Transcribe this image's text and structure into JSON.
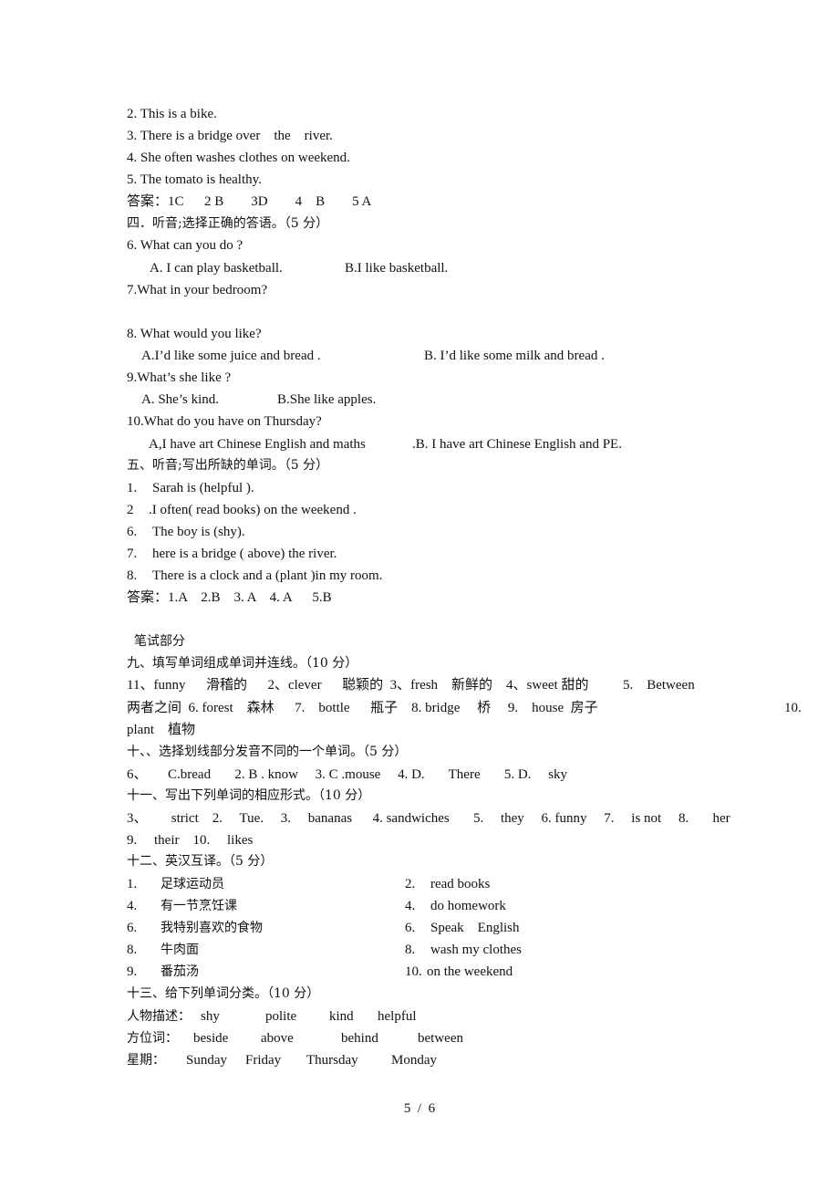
{
  "section3_tail": {
    "items": [
      "2. This is a bike.",
      "3. There is a bridge over    the    river.",
      "4. She often washes clothes on weekend.",
      "5. The tomato is healthy."
    ],
    "answer": "答案：1C      2 B        3D        4    B        5 A"
  },
  "section4": {
    "heading": "四．听音;选择正确的答语。（5 分）",
    "q6": "6. What can you do ?",
    "q6_a": "A. I can play basketball.",
    "q6_b": "B.I like basketball.",
    "q7": "7.What in your bedroom?",
    "q8": "8. What would you like?",
    "q8_a": "A.I’d like some juice and bread .",
    "q8_b": "B. I’d like some milk and bread .",
    "q9": "9.What’s she like ?",
    "q9_a": "A. She’s kind.",
    "q9_b": "B.She like apples.",
    "q10": "10.What do you have on Thursday?",
    "q10_a": "A,I have art Chinese English and maths",
    "q10_b": ".B. I have art Chinese English and PE."
  },
  "section5": {
    "heading": "五、听音;写出所缺的单词。（5 分）",
    "items": [
      {
        "num": "1.",
        "text": "Sarah is (helpful )."
      },
      {
        "num": "2",
        "text": ".I often( read books) on the weekend ."
      },
      {
        "num": "6.",
        "text": "The boy is (shy)."
      },
      {
        "num": "7.",
        "text": "here is a bridge ( above) the river."
      },
      {
        "num": "8.",
        "text": "There is a clock and a (plant )in my room."
      }
    ],
    "answer": "答案：1.A    2.B    3. A    4. A      5.B"
  },
  "written": {
    "heading": "笔试部分"
  },
  "section9": {
    "heading": "九、填写单词组成单词并连线。（10 分）",
    "line1": "11、funny      滑稽的      2、clever      聪颖的  3、fresh    新鲜的    4、sweet 甜的          5.    Between",
    "line2": "两者之间  6. forest    森林      7.    bottle      瓶子    8. bridge     桥     9.    house  房子",
    "line2_end": "10.",
    "line3": "plant    植物"
  },
  "section10": {
    "heading": "十、、选择划线部分发音不同的一个单词。（5 分）",
    "answer": "6、      C.bread       2. B . know     3. C .mouse     4. D.       There       5. D.     sky"
  },
  "section11": {
    "heading": "十一、写出下列单词的相应形式。（10 分）",
    "line1": "3、       strict    2.     Tue.     3.     bananas      4. sandwiches       5.     they     6. funny     7.     is not     8.       her",
    "line2": "9.     their    10.     likes"
  },
  "section12": {
    "heading": "十二、英汉互译。（5 分）",
    "rows": [
      {
        "l_num": "1.",
        "l_text": "足球运动员",
        "r_num": "2.",
        "r_text": "read books"
      },
      {
        "l_num": "4.",
        "l_text": "有一节烹饪课",
        "r_num": "4.",
        "r_text": "do homework"
      },
      {
        "l_num": "6.",
        "l_text": "我特别喜欢的食物",
        "r_num": "6.",
        "r_text": "Speak    English"
      },
      {
        "l_num": "8.",
        "l_text": "牛肉面",
        "r_num": "8.",
        "r_text": "wash my clothes"
      },
      {
        "l_num": "9.",
        "l_text": "番茄汤",
        "r_num": "10.",
        "r_text": "on the weekend"
      }
    ]
  },
  "section13": {
    "heading": "十三、给下列单词分类。（10 分）",
    "people_label": "人物描述：",
    "people_words": [
      "shy",
      "polite",
      "kind",
      "helpful"
    ],
    "position_label": "方位词：",
    "position_words": [
      "beside",
      "above",
      "behind",
      "between"
    ],
    "week_label": "星期：",
    "week_words": [
      "Sunday",
      "Friday",
      "Thursday",
      "Monday"
    ]
  },
  "footer": {
    "page_number": "5  /  6"
  }
}
